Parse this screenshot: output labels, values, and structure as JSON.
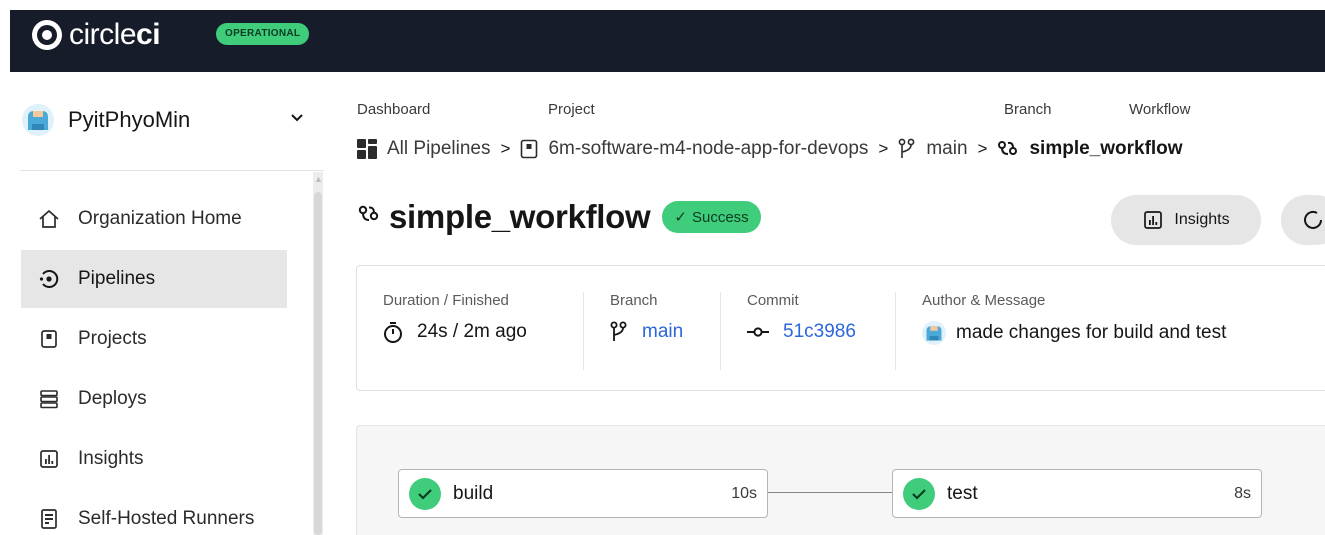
{
  "header": {
    "logo_text_light": "circle",
    "logo_text_bold": "ci",
    "status": "OPERATIONAL"
  },
  "sidebar": {
    "org_name": "PyitPhyoMin",
    "items": [
      {
        "label": "Organization Home",
        "icon": "home-icon",
        "active": false
      },
      {
        "label": "Pipelines",
        "icon": "pipelines-icon",
        "active": true
      },
      {
        "label": "Projects",
        "icon": "projects-icon",
        "active": false
      },
      {
        "label": "Deploys",
        "icon": "deploys-icon",
        "active": false
      },
      {
        "label": "Insights",
        "icon": "insights-icon",
        "active": false
      },
      {
        "label": "Self-Hosted Runners",
        "icon": "runners-icon",
        "active": false
      }
    ]
  },
  "breadcrumb": {
    "labels": {
      "dashboard": "Dashboard",
      "project": "Project",
      "branch": "Branch",
      "workflow": "Workflow"
    },
    "all_pipelines": "All Pipelines",
    "project": "6m-software-m4-node-app-for-devops",
    "branch": "main",
    "workflow": "simple_workflow"
  },
  "workflow": {
    "title": "simple_workflow",
    "status": "Success",
    "insights_label": "Insights"
  },
  "summary": {
    "duration_label": "Duration / Finished",
    "duration": "24s",
    "finished": "2m ago",
    "branch_label": "Branch",
    "branch": "main",
    "commit_label": "Commit",
    "commit": "51c3986",
    "author_label": "Author & Message",
    "message": "made changes for build and test"
  },
  "jobs": [
    {
      "name": "build",
      "duration": "10s",
      "status": "success"
    },
    {
      "name": "test",
      "duration": "8s",
      "status": "success"
    }
  ],
  "colors": {
    "topbar": "#161c2a",
    "success": "#3fcd7c",
    "link": "#2c66dd",
    "active_nav": "#e6e6e6"
  }
}
